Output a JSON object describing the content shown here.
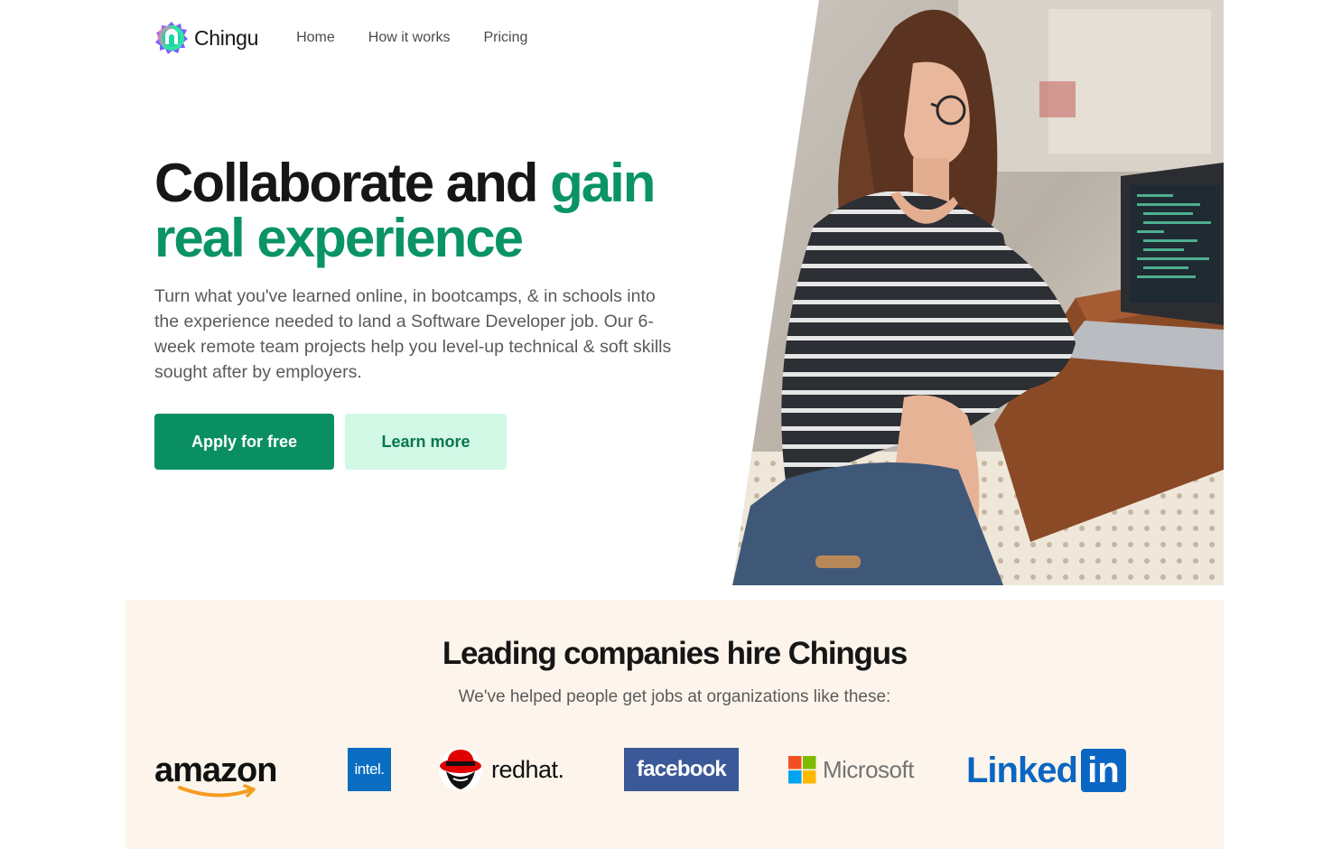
{
  "nav": {
    "brand": "Chingu",
    "links": [
      "Home",
      "How it works",
      "Pricing"
    ]
  },
  "hero": {
    "title_part1": "Collaborate and ",
    "title_accent": "gain real experience",
    "subtitle": "Turn what you've learned online, in bootcamps, & in schools into the experience needed to land a Software Developer job. Our 6-week remote team projects help you level-up technical & soft skills sought after by employers.",
    "primary_button": "Apply for free",
    "secondary_button": "Learn more"
  },
  "companies": {
    "title": "Leading companies hire Chingus",
    "subtitle": "We've helped people get jobs at organizations like these:",
    "logos": [
      "amazon",
      "intel.",
      "redhat.",
      "facebook",
      "Microsoft",
      "Linked",
      "in"
    ]
  },
  "colors": {
    "accent": "#0a9367",
    "primary_button": "#0a8f62",
    "secondary_button": "#d2f8e6",
    "band": "#fdf5eb"
  }
}
